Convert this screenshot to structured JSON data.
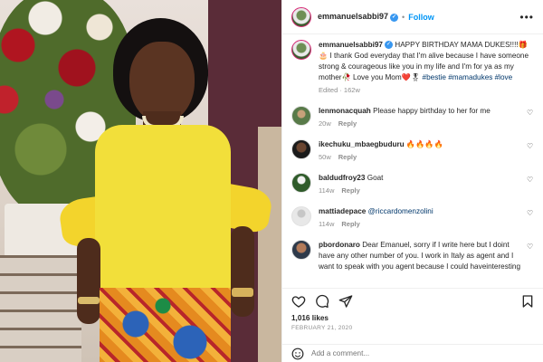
{
  "header": {
    "username": "emmanuelsabbi97",
    "dot": "•",
    "follow_label": "Follow",
    "more_label": "•••"
  },
  "caption": {
    "username": "emmanuelsabbi97",
    "text": "HAPPY BIRTHDAY MAMA DUKES!!!!🎁🎂 I thank God everyday that I'm alive because I have someone strong & courageous like you in my life and I'm for ya as my mother🥀 Love you Mom❤️🎖",
    "hashtags": "#bestie #mamadukes #love",
    "time": "Edited · 162w"
  },
  "comments": [
    {
      "username": "lenmonacquah",
      "text": "Please happy birthday to her for me",
      "time": "20w",
      "reply": "Reply"
    },
    {
      "username": "ikechuku_mbaegbuduru",
      "text": "🔥🔥🔥🔥",
      "time": "50w",
      "reply": "Reply"
    },
    {
      "username": "baldudfroy23",
      "text": "Goat",
      "time": "114w",
      "reply": "Reply"
    },
    {
      "username": "mattiadepace",
      "mention": "@riccardomenzolini",
      "time": "114w",
      "reply": "Reply"
    },
    {
      "username": "pbordonaro",
      "text": "Dear Emanuel, sorry if I write here but I doint have any other number of you. I work in Italy as agent and I want to speak with you agent because I could haveinteresting",
      "time": "",
      "reply": ""
    }
  ],
  "actions": {
    "likes": "1,016 likes",
    "date": "FEBRUARY 21, 2020"
  },
  "add_comment": {
    "placeholder": "Add a comment..."
  },
  "icons": [
    "heart-icon",
    "comment-icon",
    "share-icon",
    "bookmark-icon",
    "emoji-icon",
    "verified-icon",
    "more-icon"
  ],
  "colors": {
    "link": "#0095f6",
    "hashtag": "#00376b",
    "verified": "#3897f0",
    "meta": "#8e8e8e"
  }
}
